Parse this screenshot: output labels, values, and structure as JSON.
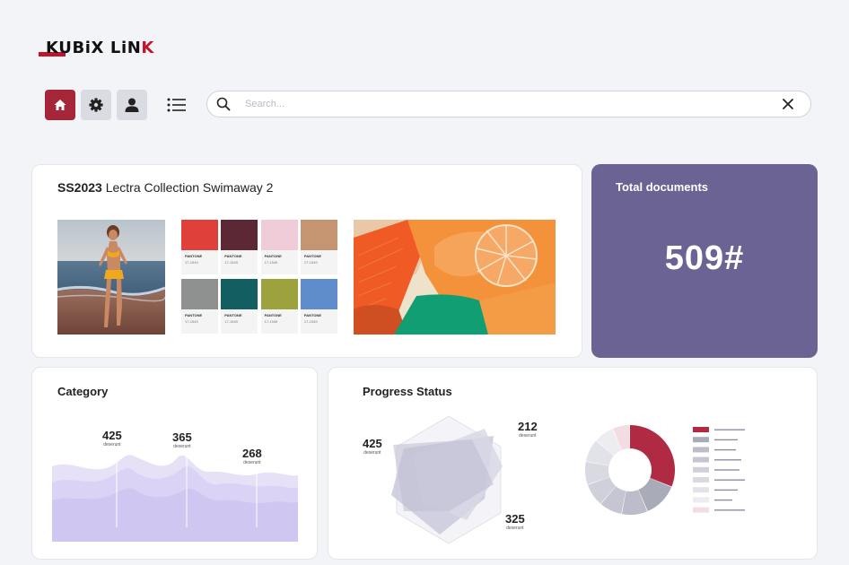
{
  "brand": {
    "name": "KUBiX LiNK",
    "accent": "#c0142c"
  },
  "toolbar": {
    "home_icon": "home-icon",
    "settings_icon": "gear-icon",
    "profile_icon": "user-icon",
    "menu_icon": "list-icon",
    "active_color": "#a52638"
  },
  "search": {
    "placeholder": "Search...",
    "value": ""
  },
  "collection": {
    "season": "SS2023",
    "name": "Lectra Collection Swimaway 2",
    "swatches": [
      {
        "color": "#e0403a",
        "label": "PANTONE",
        "code": "17-1549"
      },
      {
        "color": "#5c2835",
        "label": "PANTONE",
        "code": "17-1549"
      },
      {
        "color": "#efccd8",
        "label": "PANTONE",
        "code": "17-1549"
      },
      {
        "color": "#c49570",
        "label": "PANTONE",
        "code": "17-1549"
      },
      {
        "color": "#8f9191",
        "label": "PANTONE",
        "code": "17-1549"
      },
      {
        "color": "#125e61",
        "label": "PANTONE",
        "code": "17-1549"
      },
      {
        "color": "#9ea23c",
        "label": "PANTONE",
        "code": "17-1549"
      },
      {
        "color": "#5f8dcb",
        "label": "PANTONE",
        "code": "17-1549"
      }
    ]
  },
  "total": {
    "title": "Total documents",
    "value": "509#",
    "bg": "#6b6394"
  },
  "category": {
    "title": "Category",
    "stats": [
      {
        "value": "425",
        "label": "deserunt"
      },
      {
        "value": "365",
        "label": "deserunt"
      },
      {
        "value": "268",
        "label": "deserunt"
      }
    ]
  },
  "progress": {
    "title": "Progress Status",
    "stats": [
      {
        "value": "425",
        "label": "deserunt"
      },
      {
        "value": "212",
        "label": "deserunt"
      },
      {
        "value": "325",
        "label": "deserunt"
      }
    ],
    "donut_colors": [
      "#b12a43",
      "#a9abb8",
      "#bcbcca",
      "#c6c6d2",
      "#d0d0da",
      "#d9d9e2",
      "#e2e2ea",
      "#ececf1",
      "#f3dde2"
    ]
  }
}
